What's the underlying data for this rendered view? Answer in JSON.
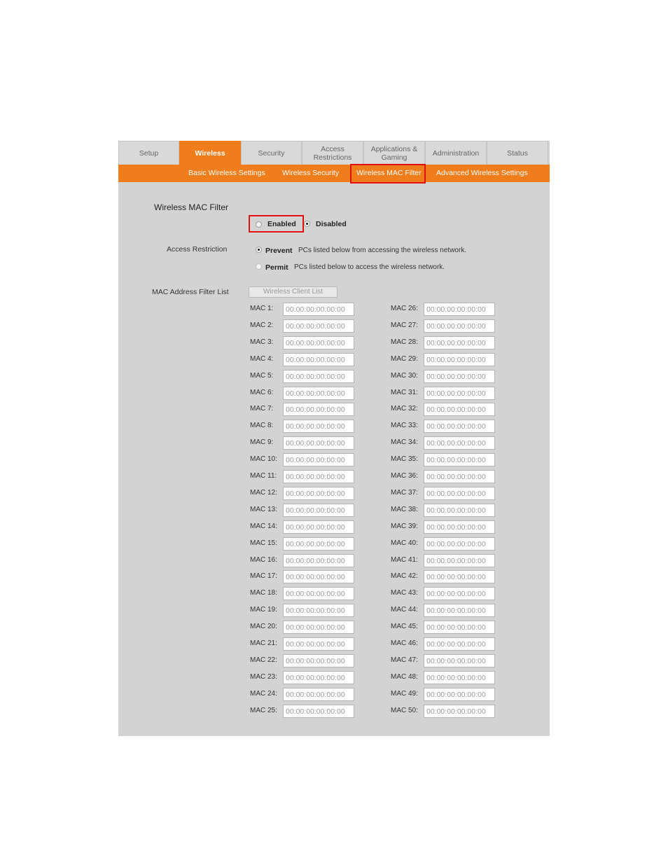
{
  "tabs": [
    {
      "label": "Setup",
      "active": false
    },
    {
      "label": "Wireless",
      "active": true
    },
    {
      "label": "Security",
      "active": false
    },
    {
      "label": "Access\nRestrictions",
      "active": false
    },
    {
      "label": "Applications &\nGaming",
      "active": false
    },
    {
      "label": "Administration",
      "active": false
    },
    {
      "label": "Status",
      "active": false
    }
  ],
  "subnav": [
    {
      "label": "Basic Wireless Settings"
    },
    {
      "label": "Wireless Security"
    },
    {
      "label": "Wireless MAC Filter",
      "highlighted": true
    },
    {
      "label": "Advanced Wireless Settings"
    }
  ],
  "filter": {
    "title": "Wireless MAC Filter",
    "enabled_label": "Enabled",
    "disabled_label": "Disabled",
    "selected": "Disabled"
  },
  "access": {
    "label": "Access Restriction",
    "prevent_label": "Prevent",
    "prevent_text": "PCs listed below from accessing the wireless network.",
    "permit_label": "Permit",
    "permit_text": "PCs listed below to access the wireless network.",
    "selected": "Prevent"
  },
  "mac_list": {
    "label": "MAC Address Filter List",
    "client_list_button": "Wireless Client List",
    "left": [
      {
        "label": "MAC 1:",
        "value": "00:00:00:00:00:00"
      },
      {
        "label": "MAC 2:",
        "value": "00:00:00:00:00:00"
      },
      {
        "label": "MAC 3:",
        "value": "00:00:00:00:00:00"
      },
      {
        "label": "MAC 4:",
        "value": "00:00:00:00:00:00"
      },
      {
        "label": "MAC 5:",
        "value": "00:00:00:00:00:00"
      },
      {
        "label": "MAC 6:",
        "value": "00:00:00:00:00:00"
      },
      {
        "label": "MAC 7:",
        "value": "00:00:00:00:00:00"
      },
      {
        "label": "MAC 8:",
        "value": "00:00:00:00:00:00"
      },
      {
        "label": "MAC 9:",
        "value": "00:00:00:00:00:00"
      },
      {
        "label": "MAC 10:",
        "value": "00:00:00:00:00:00"
      },
      {
        "label": "MAC 11:",
        "value": "00:00:00:00:00:00"
      },
      {
        "label": "MAC 12:",
        "value": "00:00:00:00:00:00"
      },
      {
        "label": "MAC 13:",
        "value": "00:00:00:00:00:00"
      },
      {
        "label": "MAC 14:",
        "value": "00:00:00:00:00:00"
      },
      {
        "label": "MAC 15:",
        "value": "00:00:00:00:00:00"
      },
      {
        "label": "MAC 16:",
        "value": "00:00:00:00:00:00"
      },
      {
        "label": "MAC 17:",
        "value": "00:00:00:00:00:00"
      },
      {
        "label": "MAC 18:",
        "value": "00:00:00:00:00:00"
      },
      {
        "label": "MAC 19:",
        "value": "00:00:00:00:00:00"
      },
      {
        "label": "MAC 20:",
        "value": "00:00:00:00:00:00"
      },
      {
        "label": "MAC 21:",
        "value": "00:00:00:00:00:00"
      },
      {
        "label": "MAC 22:",
        "value": "00:00:00:00:00:00"
      },
      {
        "label": "MAC 23:",
        "value": "00:00:00:00:00:00"
      },
      {
        "label": "MAC 24:",
        "value": "00:00:00:00:00:00"
      },
      {
        "label": "MAC 25:",
        "value": "00:00:00:00:00:00"
      }
    ],
    "right": [
      {
        "label": "MAC 26:",
        "value": "00:00:00:00:00:00"
      },
      {
        "label": "MAC 27:",
        "value": "00:00:00:00:00:00"
      },
      {
        "label": "MAC 28:",
        "value": "00:00:00:00:00:00"
      },
      {
        "label": "MAC 29:",
        "value": "00:00:00:00:00:00"
      },
      {
        "label": "MAC 30:",
        "value": "00:00:00:00:00:00"
      },
      {
        "label": "MAC 31:",
        "value": "00:00:00:00:00:00"
      },
      {
        "label": "MAC 32:",
        "value": "00:00:00:00:00:00"
      },
      {
        "label": "MAC 33:",
        "value": "00:00:00:00:00:00"
      },
      {
        "label": "MAC 34:",
        "value": "00:00:00:00:00:00"
      },
      {
        "label": "MAC 35:",
        "value": "00:00:00:00:00:00"
      },
      {
        "label": "MAC 36:",
        "value": "00:00:00:00:00:00"
      },
      {
        "label": "MAC 37:",
        "value": "00:00:00:00:00:00"
      },
      {
        "label": "MAC 38:",
        "value": "00:00:00:00:00:00"
      },
      {
        "label": "MAC 39:",
        "value": "00:00:00:00:00:00"
      },
      {
        "label": "MAC 40:",
        "value": "00:00:00:00:00:00"
      },
      {
        "label": "MAC 41:",
        "value": "00:00:00:00:00:00"
      },
      {
        "label": "MAC 42:",
        "value": "00:00:00:00:00:00"
      },
      {
        "label": "MAC 43:",
        "value": "00:00:00:00:00:00"
      },
      {
        "label": "MAC 44:",
        "value": "00:00:00:00:00:00"
      },
      {
        "label": "MAC 45:",
        "value": "00:00:00:00:00:00"
      },
      {
        "label": "MAC 46:",
        "value": "00:00:00:00:00:00"
      },
      {
        "label": "MAC 47:",
        "value": "00:00:00:00:00:00"
      },
      {
        "label": "MAC 48:",
        "value": "00:00:00:00:00:00"
      },
      {
        "label": "MAC 49:",
        "value": "00:00:00:00:00:00"
      },
      {
        "label": "MAC 50:",
        "value": "00:00:00:00:00:00"
      }
    ]
  },
  "colors": {
    "accent": "#f07d1c",
    "panel": "#d3d3d3",
    "highlight_box": "#e01010"
  }
}
